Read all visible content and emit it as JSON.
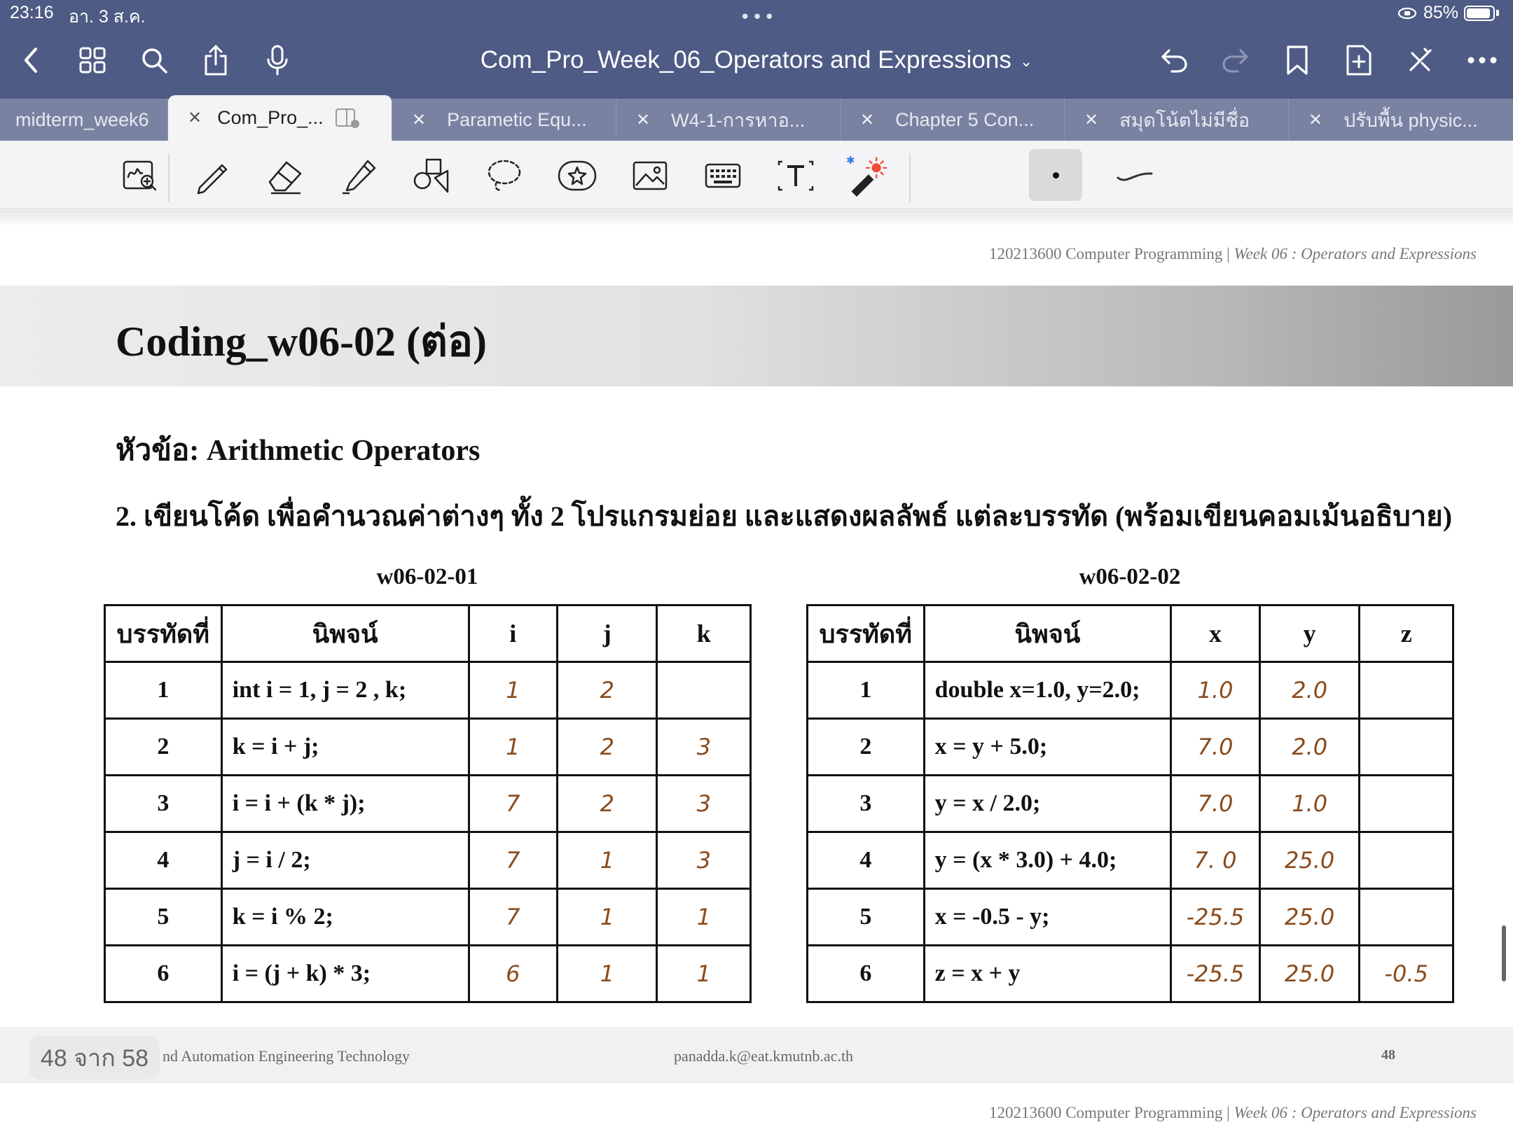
{
  "status_bar": {
    "time": "23:16",
    "date": "อา. 3 ส.ค.",
    "battery": "85%"
  },
  "document": {
    "title": "Com_Pro_Week_06_Operators and Expressions"
  },
  "tabs": [
    {
      "label": "midterm_week6"
    },
    {
      "label": "Com_Pro_..."
    },
    {
      "label": "Parametic Equ..."
    },
    {
      "label": "W4-1-การหาอ..."
    },
    {
      "label": "Chapter 5 Con..."
    },
    {
      "label": "สมุดโน้ตไม่มีชื่อ"
    },
    {
      "label": "ปรับพื้น physic..."
    }
  ],
  "page": {
    "header_course": "120213600 Computer Programming | ",
    "header_week": "Week 06 : Operators and Expressions",
    "section_title": "Coding_w06-02 (ต่อ)",
    "topic": "หัวข้อ: Arithmetic Operators",
    "question": "2. เขียนโค้ด เพื่อคำนวณค่าต่างๆ ทั้ง 2 โปรแกรมย่อย และแสดงผลลัพธ์ แต่ละบรรทัด (พร้อมเขียนคอมเม้นอธิบาย)",
    "table1": {
      "caption": "w06-02-01",
      "headers": [
        "บรรทัดที่",
        "นิพจน์",
        "i",
        "j",
        "k"
      ],
      "rows": [
        [
          "1",
          "int i = 1, j = 2 , k;",
          "1",
          "2",
          ""
        ],
        [
          "2",
          "k = i + j;",
          "1",
          "2",
          "3"
        ],
        [
          "3",
          "i = i + (k * j);",
          "7",
          "2",
          "3"
        ],
        [
          "4",
          "j = i / 2;",
          "7",
          "1",
          "3"
        ],
        [
          "5",
          "k = i % 2;",
          "7",
          "1",
          "1"
        ],
        [
          "6",
          "i = (j + k) * 3;",
          "6",
          "1",
          "1"
        ]
      ]
    },
    "table2": {
      "caption": "w06-02-02",
      "headers": [
        "บรรทัดที่",
        "นิพจน์",
        "x",
        "y",
        "z"
      ],
      "rows": [
        [
          "1",
          "double x=1.0, y=2.0;",
          "1.0",
          "2.0",
          ""
        ],
        [
          "2",
          "x = y + 5.0;",
          "7.0",
          "2.0",
          ""
        ],
        [
          "3",
          "y = x / 2.0;",
          "7.0",
          "1.0",
          ""
        ],
        [
          "4",
          "y = (x * 3.0) + 4.0;",
          "7. 0",
          "25.0",
          ""
        ],
        [
          "5",
          "x = -0.5 - y;",
          "-25.5",
          "25.0",
          ""
        ],
        [
          "6",
          "z = x + y",
          "-25.5",
          "25.0",
          "-0.5"
        ]
      ]
    },
    "footer_left": "nd Automation Engineering Technology",
    "footer_email": "panadda.k@eat.kmutnb.ac.th",
    "footer_page": "48",
    "page_indicator": "48 จาก 58"
  },
  "icons": {
    "nav": [
      "back-icon",
      "grid-icon",
      "search-icon",
      "share-icon",
      "microphone-icon",
      "undo-icon",
      "redo-icon",
      "bookmark-icon",
      "add-page-icon",
      "close-edit-icon",
      "more-icon"
    ],
    "tools": [
      "zoom-write-icon",
      "pen-icon",
      "eraser-icon",
      "highlighter-icon",
      "shapes-icon",
      "lasso-icon",
      "sticker-icon",
      "image-icon",
      "keyboard-icon",
      "text-icon",
      "laser-pointer-icon"
    ]
  },
  "colors": {
    "title_bar": "#4e5b85",
    "tab_bar": "#7a82a2",
    "handwriting": "#8a4b1c"
  }
}
